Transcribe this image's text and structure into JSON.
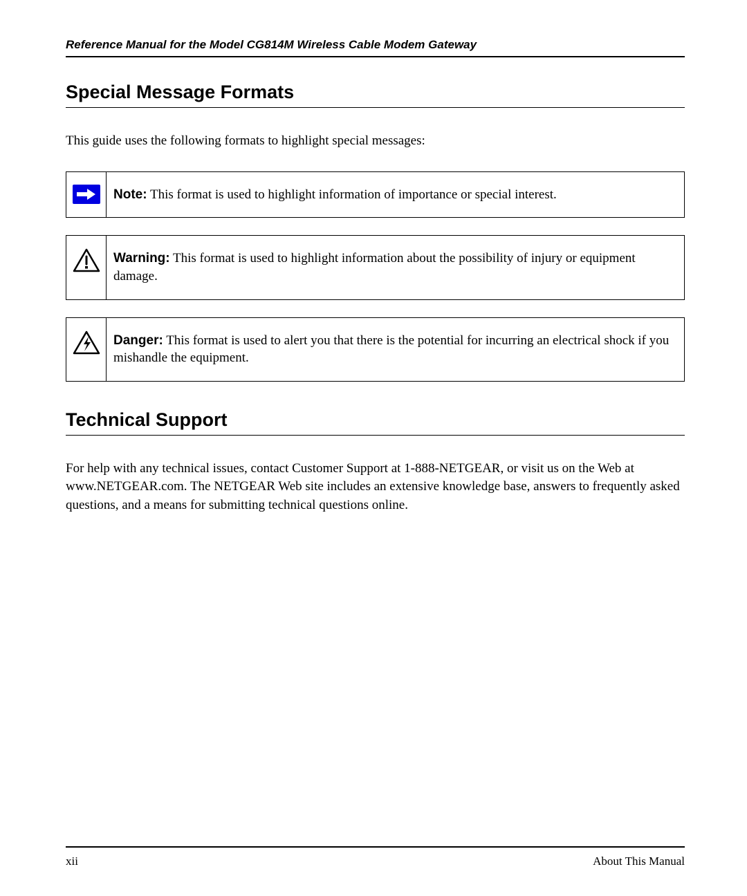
{
  "header": {
    "title": "Reference Manual for the Model CG814M Wireless Cable Modem Gateway"
  },
  "sections": {
    "special_formats": {
      "heading": "Special Message Formats",
      "intro": "This guide uses the following formats to highlight special messages:",
      "note": {
        "label": "Note:",
        "text": " This format is used to highlight information of importance or special interest."
      },
      "warning": {
        "label": "Warning:",
        "text": " This format is used to highlight information about the possibility of injury or equipment damage."
      },
      "danger": {
        "label": "Danger:",
        "text": " This format is used to alert you that there is the potential for incurring an electrical shock if you mishandle the equipment."
      }
    },
    "technical_support": {
      "heading": "Technical Support",
      "body": "For help with any technical issues, contact Customer Support at 1-888-NETGEAR, or visit us on the Web at www.NETGEAR.com. The NETGEAR Web site includes an extensive knowledge base, answers to frequently asked questions, and a means for submitting technical questions online."
    }
  },
  "footer": {
    "page_number": "xii",
    "section_name": "About This Manual"
  }
}
